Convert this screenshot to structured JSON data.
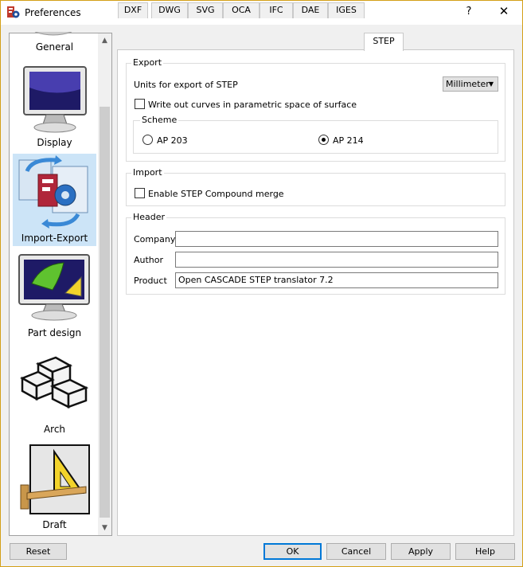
{
  "window": {
    "title": "Preferences",
    "help_symbol": "?",
    "close_symbol": "✕"
  },
  "sidebar": {
    "items": [
      {
        "label": "General",
        "icon": "general-icon"
      },
      {
        "label": "Display",
        "icon": "monitor-icon"
      },
      {
        "label": "Import-Export",
        "icon": "import-export-icon",
        "selected": true
      },
      {
        "label": "Part design",
        "icon": "part-design-icon"
      },
      {
        "label": "Arch",
        "icon": "arch-bricks-icon"
      },
      {
        "label": "Draft",
        "icon": "draft-icon"
      }
    ],
    "scroll_up": "▲",
    "scroll_down": "▼"
  },
  "tabs": [
    "DXF",
    "DWG",
    "SVG",
    "OCA",
    "IFC",
    "DAE",
    "IGES",
    "STEP"
  ],
  "active_tab": "STEP",
  "export": {
    "title": "Export",
    "units_label": "Units for export of STEP",
    "units_value": "Millimeter",
    "write_curves_label": "Write out curves in parametric space of surface",
    "write_curves_checked": false,
    "scheme": {
      "title": "Scheme",
      "ap203_label": "AP 203",
      "ap214_label": "AP 214",
      "selected": "AP 214"
    }
  },
  "import": {
    "title": "Import",
    "compound_merge_label": "Enable STEP Compound merge",
    "compound_merge_checked": false
  },
  "header": {
    "title": "Header",
    "company_label": "Company",
    "company_value": "",
    "author_label": "Author",
    "author_value": "",
    "product_label": "Product",
    "product_value": "Open CASCADE STEP translator 7.2"
  },
  "buttons": {
    "reset": "Reset",
    "ok": "OK",
    "cancel": "Cancel",
    "apply": "Apply",
    "help": "Help"
  },
  "colors": {
    "accent": "#0078d7",
    "selection": "#cce4f7",
    "window_border": "#d4a017"
  }
}
